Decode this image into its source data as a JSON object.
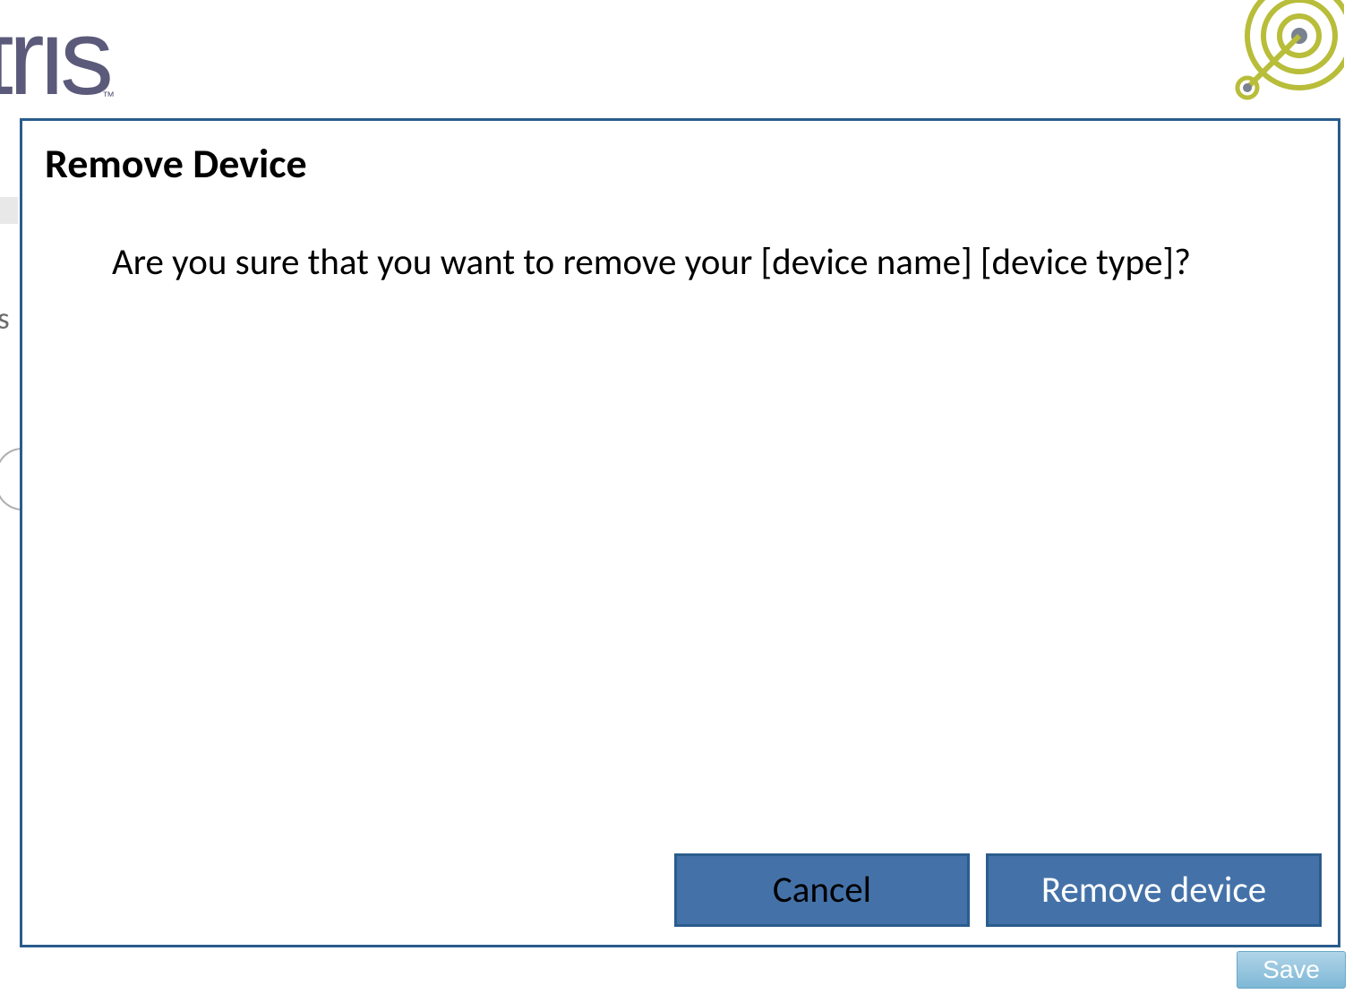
{
  "background": {
    "logo_text": "ɪrıs",
    "logo_tm": "™",
    "partial_letter": "s",
    "save_button_label": "Save"
  },
  "dialog": {
    "title": "Remove Device",
    "message": "Are you sure that you want to remove your [device name] [device type]?",
    "cancel_label": "Cancel",
    "confirm_label": "Remove device"
  },
  "colors": {
    "dialog_border": "#2a5c8d",
    "button_bg": "#4472a8",
    "logo_color": "#5b5a7a",
    "accent_olive": "#b8bd3a",
    "accent_grey": "#7a8290"
  }
}
